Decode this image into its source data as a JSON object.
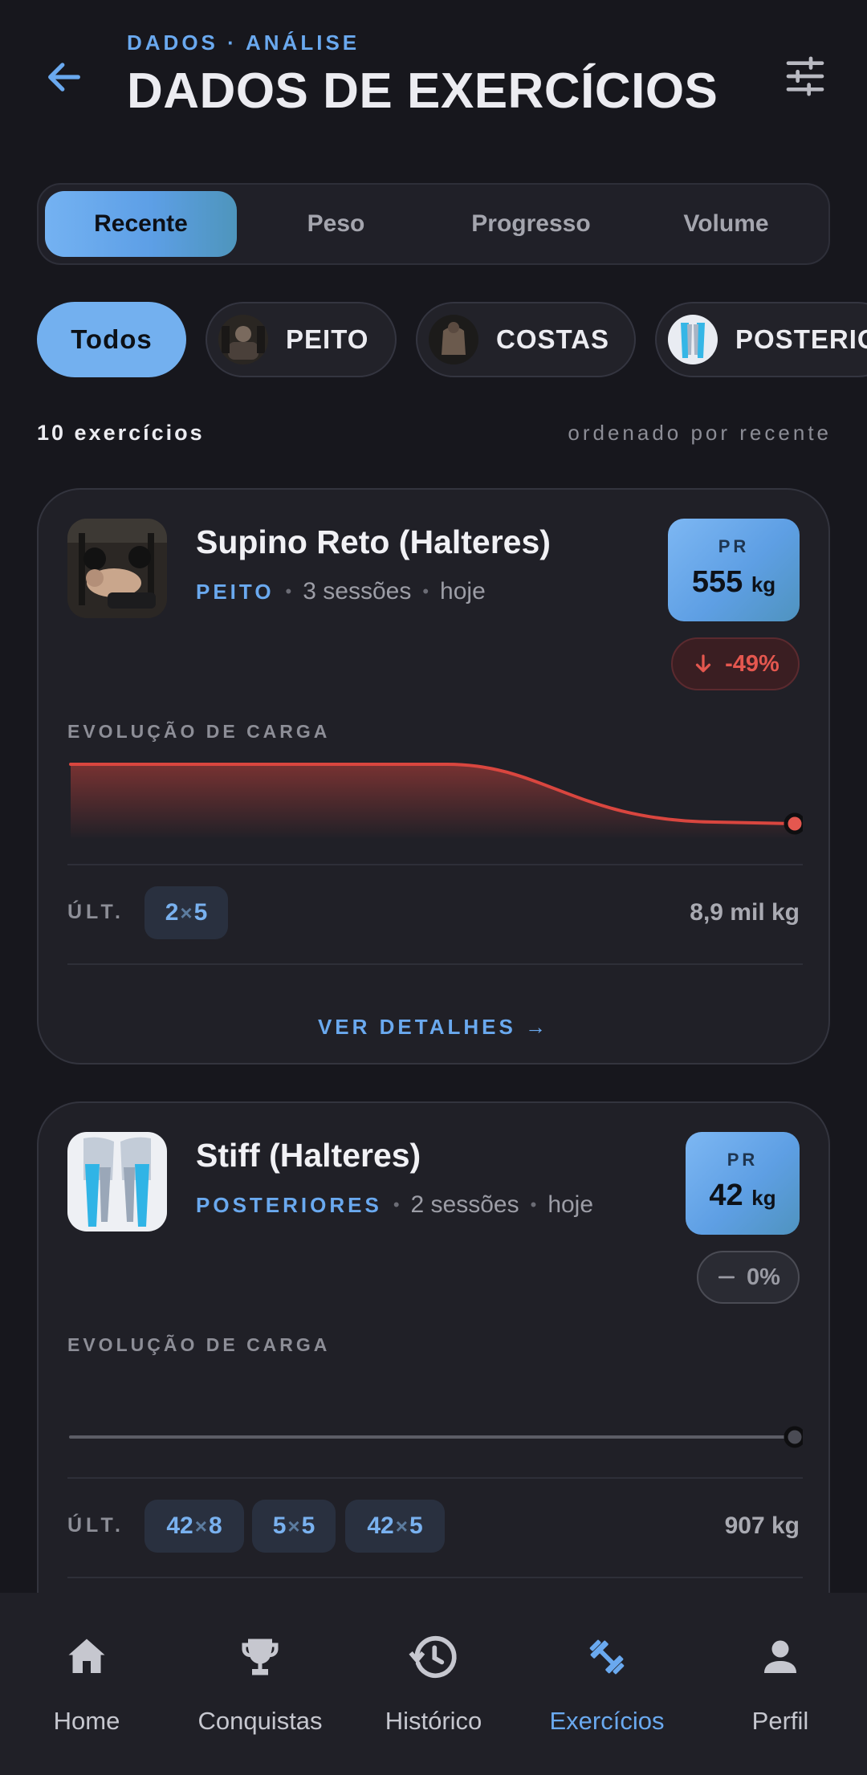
{
  "header": {
    "eyebrow": "DADOS · ANÁLISE",
    "title": "DADOS DE EXERCÍCIOS",
    "back_icon": "arrow-left-icon",
    "filter_icon": "sliders-icon"
  },
  "tabs": [
    {
      "label": "Recente",
      "active": true
    },
    {
      "label": "Peso",
      "active": false
    },
    {
      "label": "Progresso",
      "active": false
    },
    {
      "label": "Volume",
      "active": false
    }
  ],
  "categories": [
    {
      "label": "Todos",
      "active": true
    },
    {
      "label": "PEITO",
      "active": false
    },
    {
      "label": "COSTAS",
      "active": false
    },
    {
      "label": "POSTERIORES",
      "active": false
    }
  ],
  "list_meta": {
    "count": "10 exercícios",
    "sort": "ordenado por recente"
  },
  "exercises": [
    {
      "name": "Supino Reto (Halteres)",
      "category": "PEITO",
      "sessions": "3 sessões",
      "when": "hoje",
      "pr_label": "PR",
      "pr_value": "555",
      "pr_unit": "kg",
      "change": "-49%",
      "change_direction": "down",
      "chart_label": "EVOLUÇÃO DE CARGA",
      "load_series": [
        555,
        555,
        282
      ],
      "ult_label": "ÚLT.",
      "sets": [
        {
          "weight": "2",
          "reps": "5"
        }
      ],
      "volume": "8,9 mil kg",
      "details": "VER DETALHES →"
    },
    {
      "name": "Stiff (Halteres)",
      "category": "POSTERIORES",
      "sessions": "2 sessões",
      "when": "hoje",
      "pr_label": "PR",
      "pr_value": "42",
      "pr_unit": "kg",
      "change": "0%",
      "change_direction": "flat",
      "chart_label": "EVOLUÇÃO DE CARGA",
      "load_series": [
        42,
        42
      ],
      "ult_label": "ÚLT.",
      "sets": [
        {
          "weight": "42",
          "reps": "8"
        },
        {
          "weight": "5",
          "reps": "5"
        },
        {
          "weight": "42",
          "reps": "5"
        }
      ],
      "volume": "907 kg"
    }
  ],
  "bottom_nav": [
    {
      "label": "Home",
      "icon": "home-icon",
      "active": false
    },
    {
      "label": "Conquistas",
      "icon": "trophy-icon",
      "active": false
    },
    {
      "label": "Histórico",
      "icon": "history-icon",
      "active": false
    },
    {
      "label": "Exercícios",
      "icon": "dumbbell-icon",
      "active": true
    },
    {
      "label": "Perfil",
      "icon": "person-icon",
      "active": false
    }
  ],
  "colors": {
    "accent": "#6aa9ef",
    "background": "#17171d",
    "card": "#202027",
    "decline": "#e4574f"
  }
}
